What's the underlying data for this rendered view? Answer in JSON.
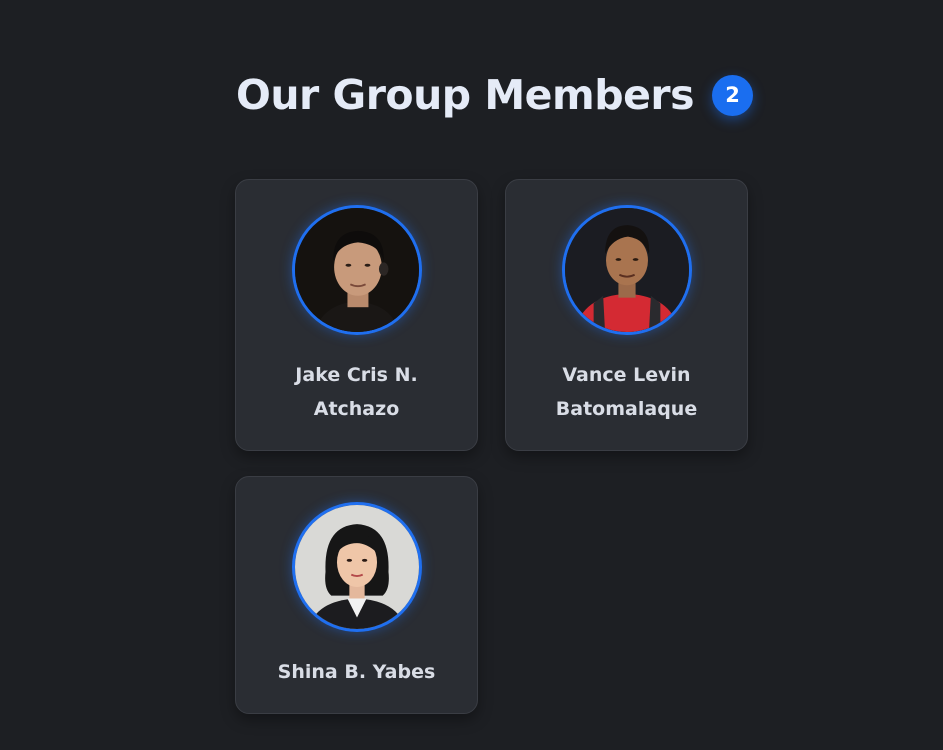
{
  "header": {
    "title": "Our Group Members",
    "count_badge": "2"
  },
  "members": [
    {
      "name": "Jake Cris N. Atchazo",
      "avatar_icon": "member-photo"
    },
    {
      "name": "Vance Levin Batomalaque",
      "avatar_icon": "member-photo"
    },
    {
      "name": "Shina B. Yabes",
      "avatar_icon": "member-photo"
    }
  ],
  "colors": {
    "background": "#1d1f23",
    "card": "#2a2d33",
    "accent": "#1a6ef0",
    "title": "#e5ebf7"
  }
}
